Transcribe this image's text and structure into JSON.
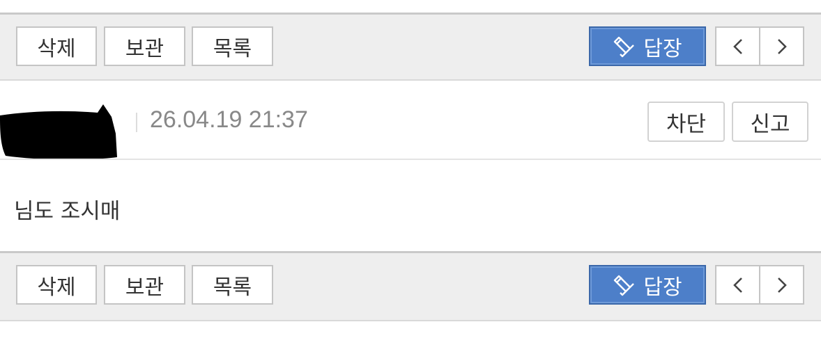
{
  "toolbar": {
    "delete_label": "삭제",
    "archive_label": "보관",
    "list_label": "목록",
    "reply_label": "답장",
    "prev_icon": "chevron-left-icon",
    "next_icon": "chevron-right-icon",
    "reply_icon": "reply-pen-icon"
  },
  "message": {
    "timestamp": "26.04.19 21:37",
    "block_label": "차단",
    "report_label": "신고",
    "body": "님도 조시매"
  },
  "colors": {
    "toolbar_bg": "#eeeeee",
    "reply_bg": "#4d7fc9",
    "text": "#333333",
    "muted": "#888888"
  }
}
